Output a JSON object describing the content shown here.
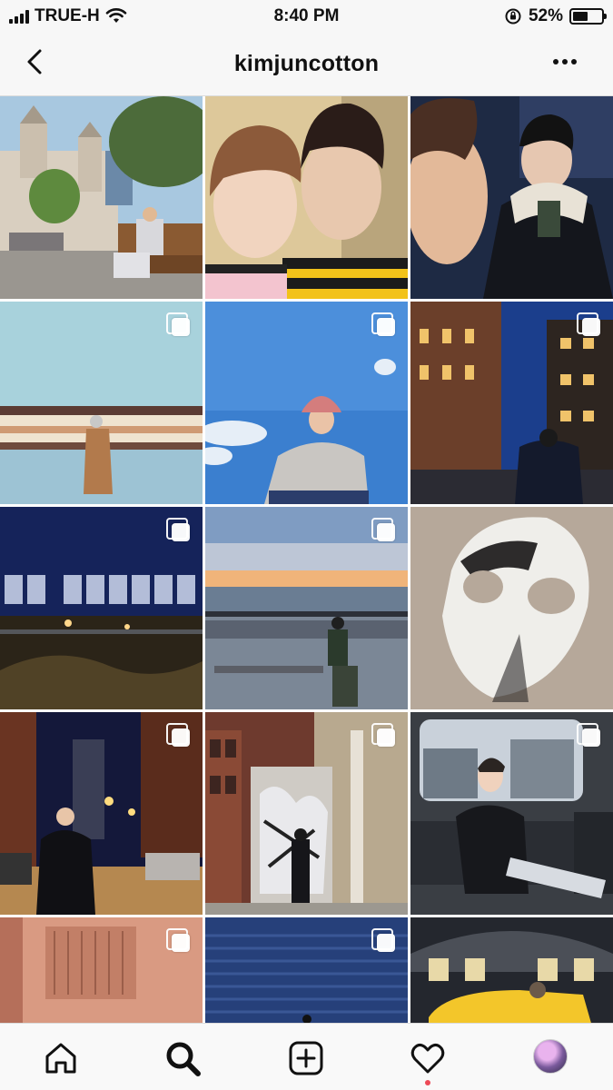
{
  "status_bar": {
    "carrier": "TRUE-H",
    "time": "8:40 PM",
    "battery_text": "52%",
    "battery_level": 0.52,
    "icons": [
      "signal-bars-icon",
      "wifi-icon",
      "orientation-lock-icon",
      "battery-icon"
    ]
  },
  "header": {
    "username": "kimjuncotton",
    "back_icon": "chevron-left-icon",
    "more_icon": "more-dots-icon"
  },
  "grid": {
    "posts": [
      {
        "subject": "plaza-with-cathedral",
        "multi": false
      },
      {
        "subject": "two-person-selfie",
        "multi": false
      },
      {
        "subject": "night-selfie-duo",
        "multi": false
      },
      {
        "subject": "striped-wall-coat",
        "multi": true
      },
      {
        "subject": "sky-bucket-hat",
        "multi": true
      },
      {
        "subject": "highline-night",
        "multi": true
      },
      {
        "subject": "neon-sign-night",
        "multi": true
      },
      {
        "subject": "pier-bench-sunset",
        "multi": true
      },
      {
        "subject": "white-mask",
        "multi": false
      },
      {
        "subject": "bridge-street-night",
        "multi": true
      },
      {
        "subject": "graffiti-door",
        "multi": true
      },
      {
        "subject": "subway-seat",
        "multi": true
      },
      {
        "subject": "pink-building",
        "multi": true
      },
      {
        "subject": "blue-shutter",
        "multi": true
      },
      {
        "subject": "yellow-taxi-station",
        "multi": false
      }
    ]
  },
  "tabbar": {
    "tabs": [
      "home-icon",
      "search-icon",
      "new-post-icon",
      "activity-heart-icon",
      "profile-avatar"
    ],
    "active": "search-icon",
    "notification_color": "#ed4956"
  }
}
